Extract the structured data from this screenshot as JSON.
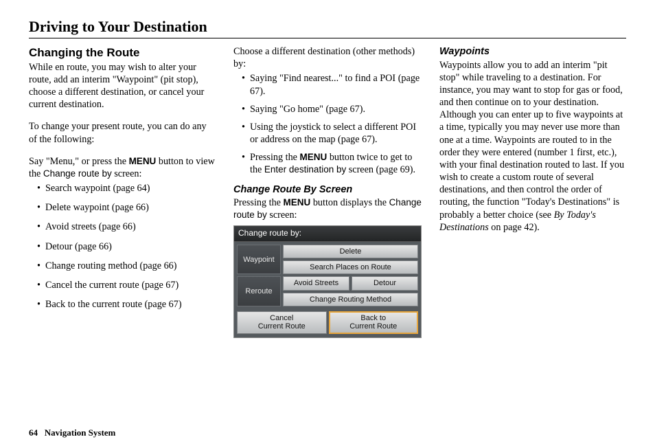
{
  "page_title": "Driving to Your Destination",
  "footer": {
    "page_number": "64",
    "label": "Navigation System"
  },
  "col1": {
    "heading": "Changing the Route",
    "intro": "While en route, you may wish to alter your route, add an interim \"Waypoint\" (pit stop), choose a different destination, or cancel your current destination.",
    "followup": "To change your present route, you can do any of the following:",
    "menu_para_prefix": "Say \"Menu,\" or press the ",
    "menu_button": "MENU",
    "menu_para_mid": " button to view the ",
    "menu_para_screen": "Change route by",
    "menu_para_suffix": " screen:",
    "items": [
      "Search waypoint (page 64)",
      "Delete waypoint (page 66)",
      "Avoid streets (page 66)",
      "Detour (page 66)",
      "Change routing method (page 66)",
      "Cancel the current route (page 67)",
      "Back to the current route (page 67)"
    ]
  },
  "col2": {
    "lead": "Choose a different destination (other methods) by:",
    "items": [
      {
        "text": "Saying \"Find nearest...\" to find a POI (page 67)."
      },
      {
        "text": "Saying \"Go home\" (page 67)."
      },
      {
        "text": "Using the joystick to select a different POI or address on the map (page 67)."
      },
      {
        "pre": "Pressing the ",
        "bold": "MENU",
        "mid": " button twice to get to the ",
        "screen": "Enter destination by",
        "post": " screen (page 69)."
      }
    ],
    "subhead": "Change Route By Screen",
    "sub_para_pre": "Pressing the ",
    "sub_para_bold": "MENU",
    "sub_para_mid": " button displays the ",
    "sub_para_screen": "Change route by",
    "sub_para_post": " screen:",
    "nav": {
      "title": "Change route by:",
      "waypoint_label": "Waypoint",
      "reroute_label": "Reroute",
      "btn_delete": "Delete",
      "btn_search": "Search Places on Route",
      "btn_avoid": "Avoid Streets",
      "btn_detour": "Detour",
      "btn_method": "Change Routing Method",
      "btn_cancel": "Cancel\nCurrent Route",
      "btn_back": "Back to\nCurrent Route"
    }
  },
  "col3": {
    "subhead": "Waypoints",
    "body_pre": "Waypoints allow you to add an interim \"pit stop\" while traveling to a destination. For instance, you may want to stop for gas or food, and then continue on to your destination. Although you can enter up to five waypoints at a time, typically you may never use more than one at a time. Waypoints are routed to in the order they were entered (number 1 first, etc.), with your final destination routed to last. If you wish to create a custom route of several destinations, and then control the order of routing, the function \"Today's Destinations\" is probably a better choice (see ",
    "body_italic": "By Today's Destinations",
    "body_post": " on page 42)."
  }
}
